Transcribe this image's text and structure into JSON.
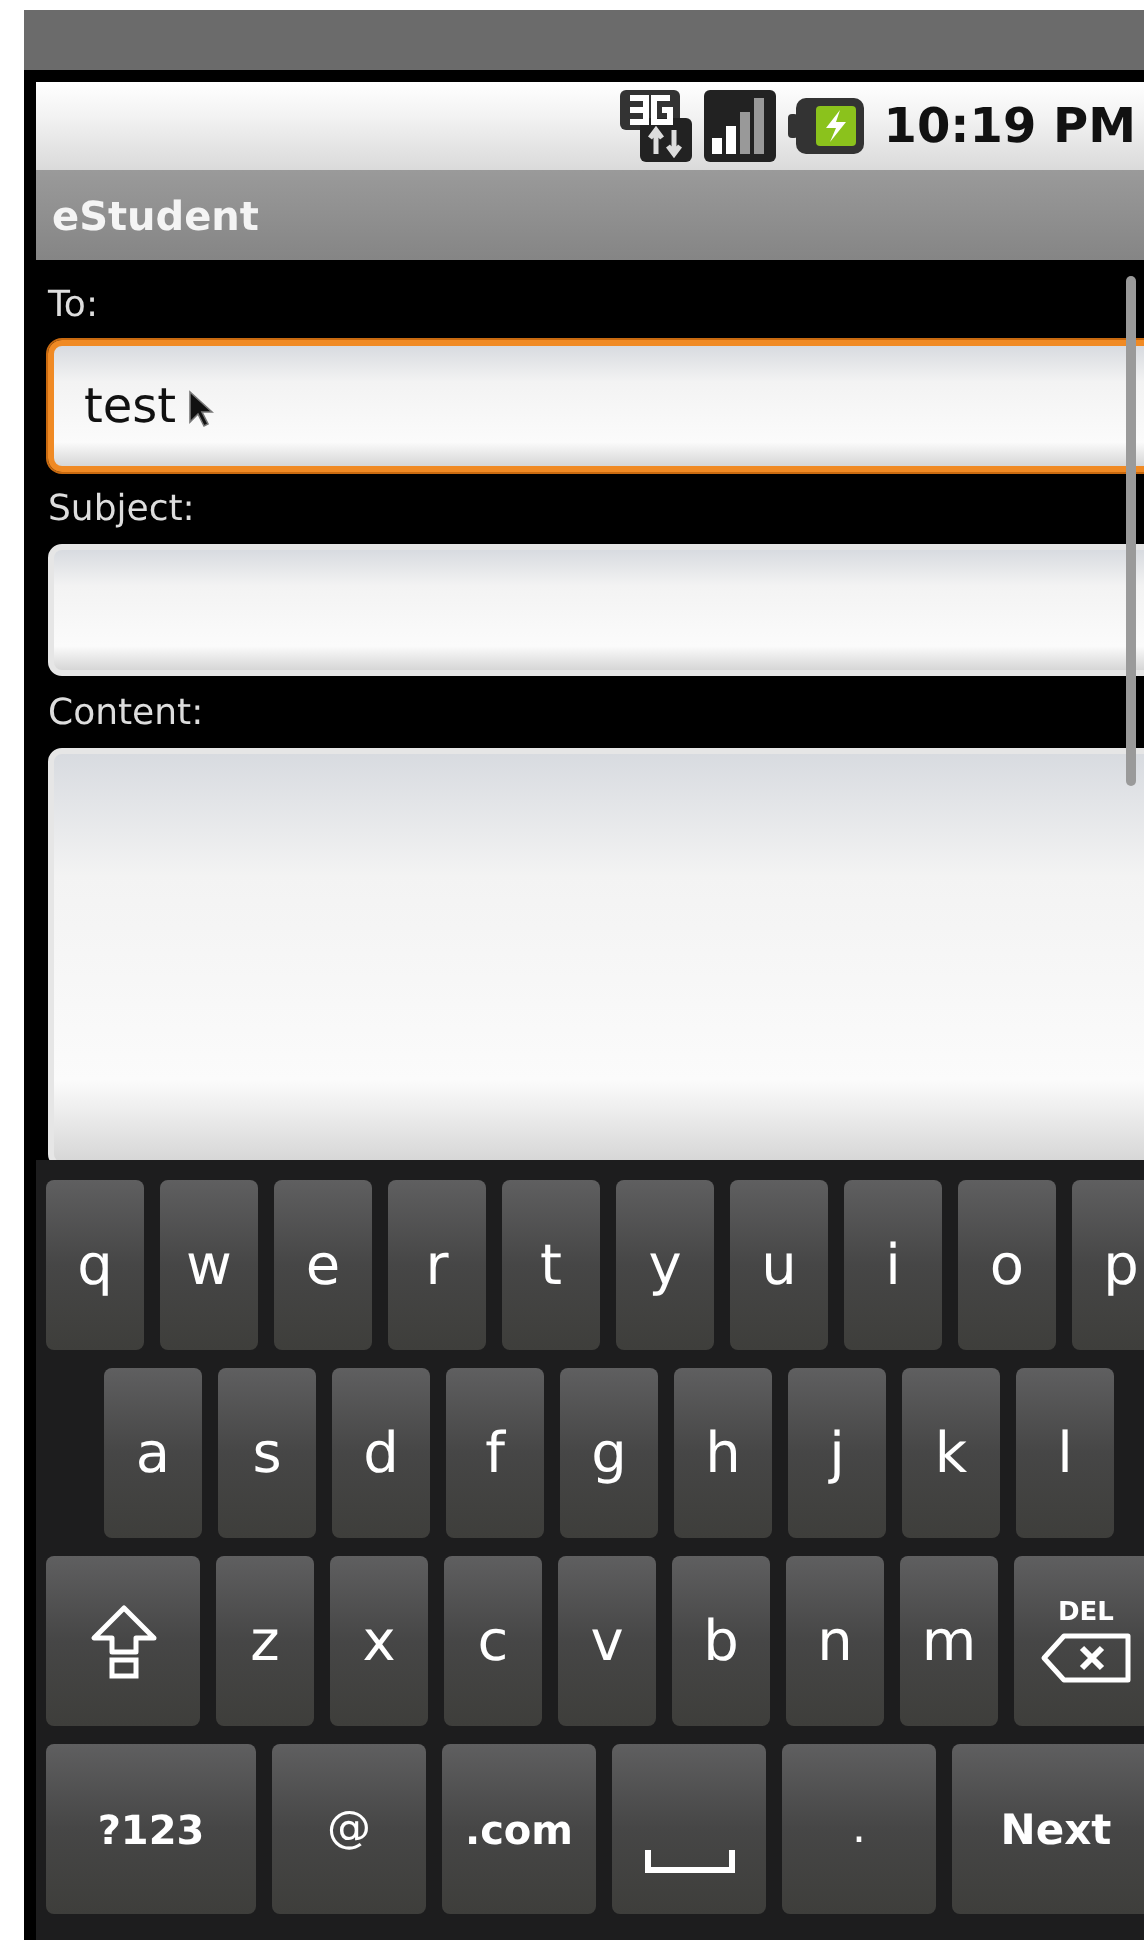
{
  "status_bar": {
    "time": "10:19 PM"
  },
  "app_bar": {
    "title": "eStudent"
  },
  "form": [
    {
      "label": "To:",
      "kind": "line",
      "value": "test",
      "focused": true
    },
    {
      "label": "Subject:",
      "kind": "line",
      "focused": false
    },
    {
      "label": "Content:",
      "kind": "multiline",
      "focused": false
    }
  ],
  "keyboard": [
    [
      {
        "kind": "char",
        "label": "q"
      },
      {
        "kind": "char",
        "label": "w"
      },
      {
        "kind": "char",
        "label": "e"
      },
      {
        "kind": "char",
        "label": "r"
      },
      {
        "kind": "char",
        "label": "t"
      },
      {
        "kind": "char",
        "label": "y"
      },
      {
        "kind": "char",
        "label": "u"
      },
      {
        "kind": "char",
        "label": "i"
      },
      {
        "kind": "char",
        "label": "o"
      },
      {
        "kind": "char",
        "label": "p"
      }
    ],
    [
      {
        "kind": "char",
        "label": "a"
      },
      {
        "kind": "char",
        "label": "s"
      },
      {
        "kind": "char",
        "label": "d"
      },
      {
        "kind": "char",
        "label": "f"
      },
      {
        "kind": "char",
        "label": "g"
      },
      {
        "kind": "char",
        "label": "h"
      },
      {
        "kind": "char",
        "label": "j"
      },
      {
        "kind": "char",
        "label": "k"
      },
      {
        "kind": "char",
        "label": "l"
      }
    ],
    [
      {
        "kind": "shift"
      },
      {
        "kind": "char",
        "label": "z"
      },
      {
        "kind": "char",
        "label": "x"
      },
      {
        "kind": "char",
        "label": "c"
      },
      {
        "kind": "char",
        "label": "v"
      },
      {
        "kind": "char",
        "label": "b"
      },
      {
        "kind": "char",
        "label": "n"
      },
      {
        "kind": "char",
        "label": "m"
      },
      {
        "kind": "delete",
        "label": "DEL"
      }
    ],
    [
      {
        "kind": "mode",
        "label": "?123"
      },
      {
        "kind": "char",
        "label": "@"
      },
      {
        "kind": "word",
        "label": ".com"
      },
      {
        "kind": "space"
      },
      {
        "kind": "char",
        "label": "."
      },
      {
        "kind": "action",
        "label": "Next"
      }
    ]
  ]
}
